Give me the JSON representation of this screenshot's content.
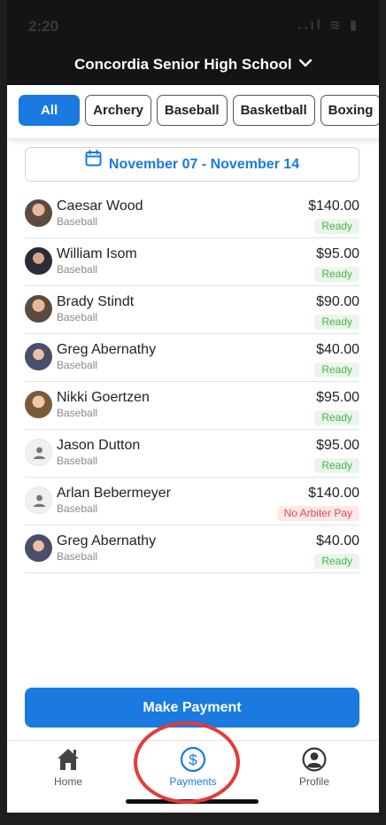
{
  "status_bar": {
    "time": "2:20",
    "icons": "..ıl  ≋  ▮"
  },
  "header": {
    "title": "Concordia Senior High School"
  },
  "filters": [
    {
      "label": "All",
      "active": true
    },
    {
      "label": "Archery"
    },
    {
      "label": "Baseball"
    },
    {
      "label": "Basketball"
    },
    {
      "label": "Boxing"
    }
  ],
  "date_range": "November 07 - November 14",
  "payments": [
    {
      "name": "Caesar Wood",
      "sport": "Baseball",
      "amount": "$140.00",
      "status": "Ready"
    },
    {
      "name": "William Isom",
      "sport": "Baseball",
      "amount": "$95.00",
      "status": "Ready"
    },
    {
      "name": "Brady Stindt",
      "sport": "Baseball",
      "amount": "$90.00",
      "status": "Ready"
    },
    {
      "name": "Greg Abernathy",
      "sport": "Baseball",
      "amount": "$40.00",
      "status": "Ready"
    },
    {
      "name": "Nikki Goertzen",
      "sport": "Baseball",
      "amount": "$95.00",
      "status": "Ready"
    },
    {
      "name": "Jason Dutton",
      "sport": "Baseball",
      "amount": "$95.00",
      "status": "Ready"
    },
    {
      "name": "Arlan Bebermeyer",
      "sport": "Baseball",
      "amount": "$140.00",
      "status": "No Arbiter Pay"
    },
    {
      "name": "Greg Abernathy",
      "sport": "Baseball",
      "amount": "$40.00",
      "status": "Ready"
    }
  ],
  "make_payment_label": "Make Payment",
  "tabs": {
    "home": "Home",
    "payments": "Payments",
    "profile": "Profile"
  },
  "icons": {
    "avatars": [
      "photo",
      "photo2",
      "photo",
      "photo4",
      "photo3",
      "default-person-icon",
      "default-person-icon",
      "photo4"
    ],
    "tab_home": "home-icon",
    "tab_payments": "dollar-circle-icon",
    "tab_profile": "profile-icon"
  },
  "colors": {
    "accent": "#1a7ae0",
    "ready": "#4cb050",
    "warning": "#e24c4c",
    "highlight": "#e53a3a"
  }
}
